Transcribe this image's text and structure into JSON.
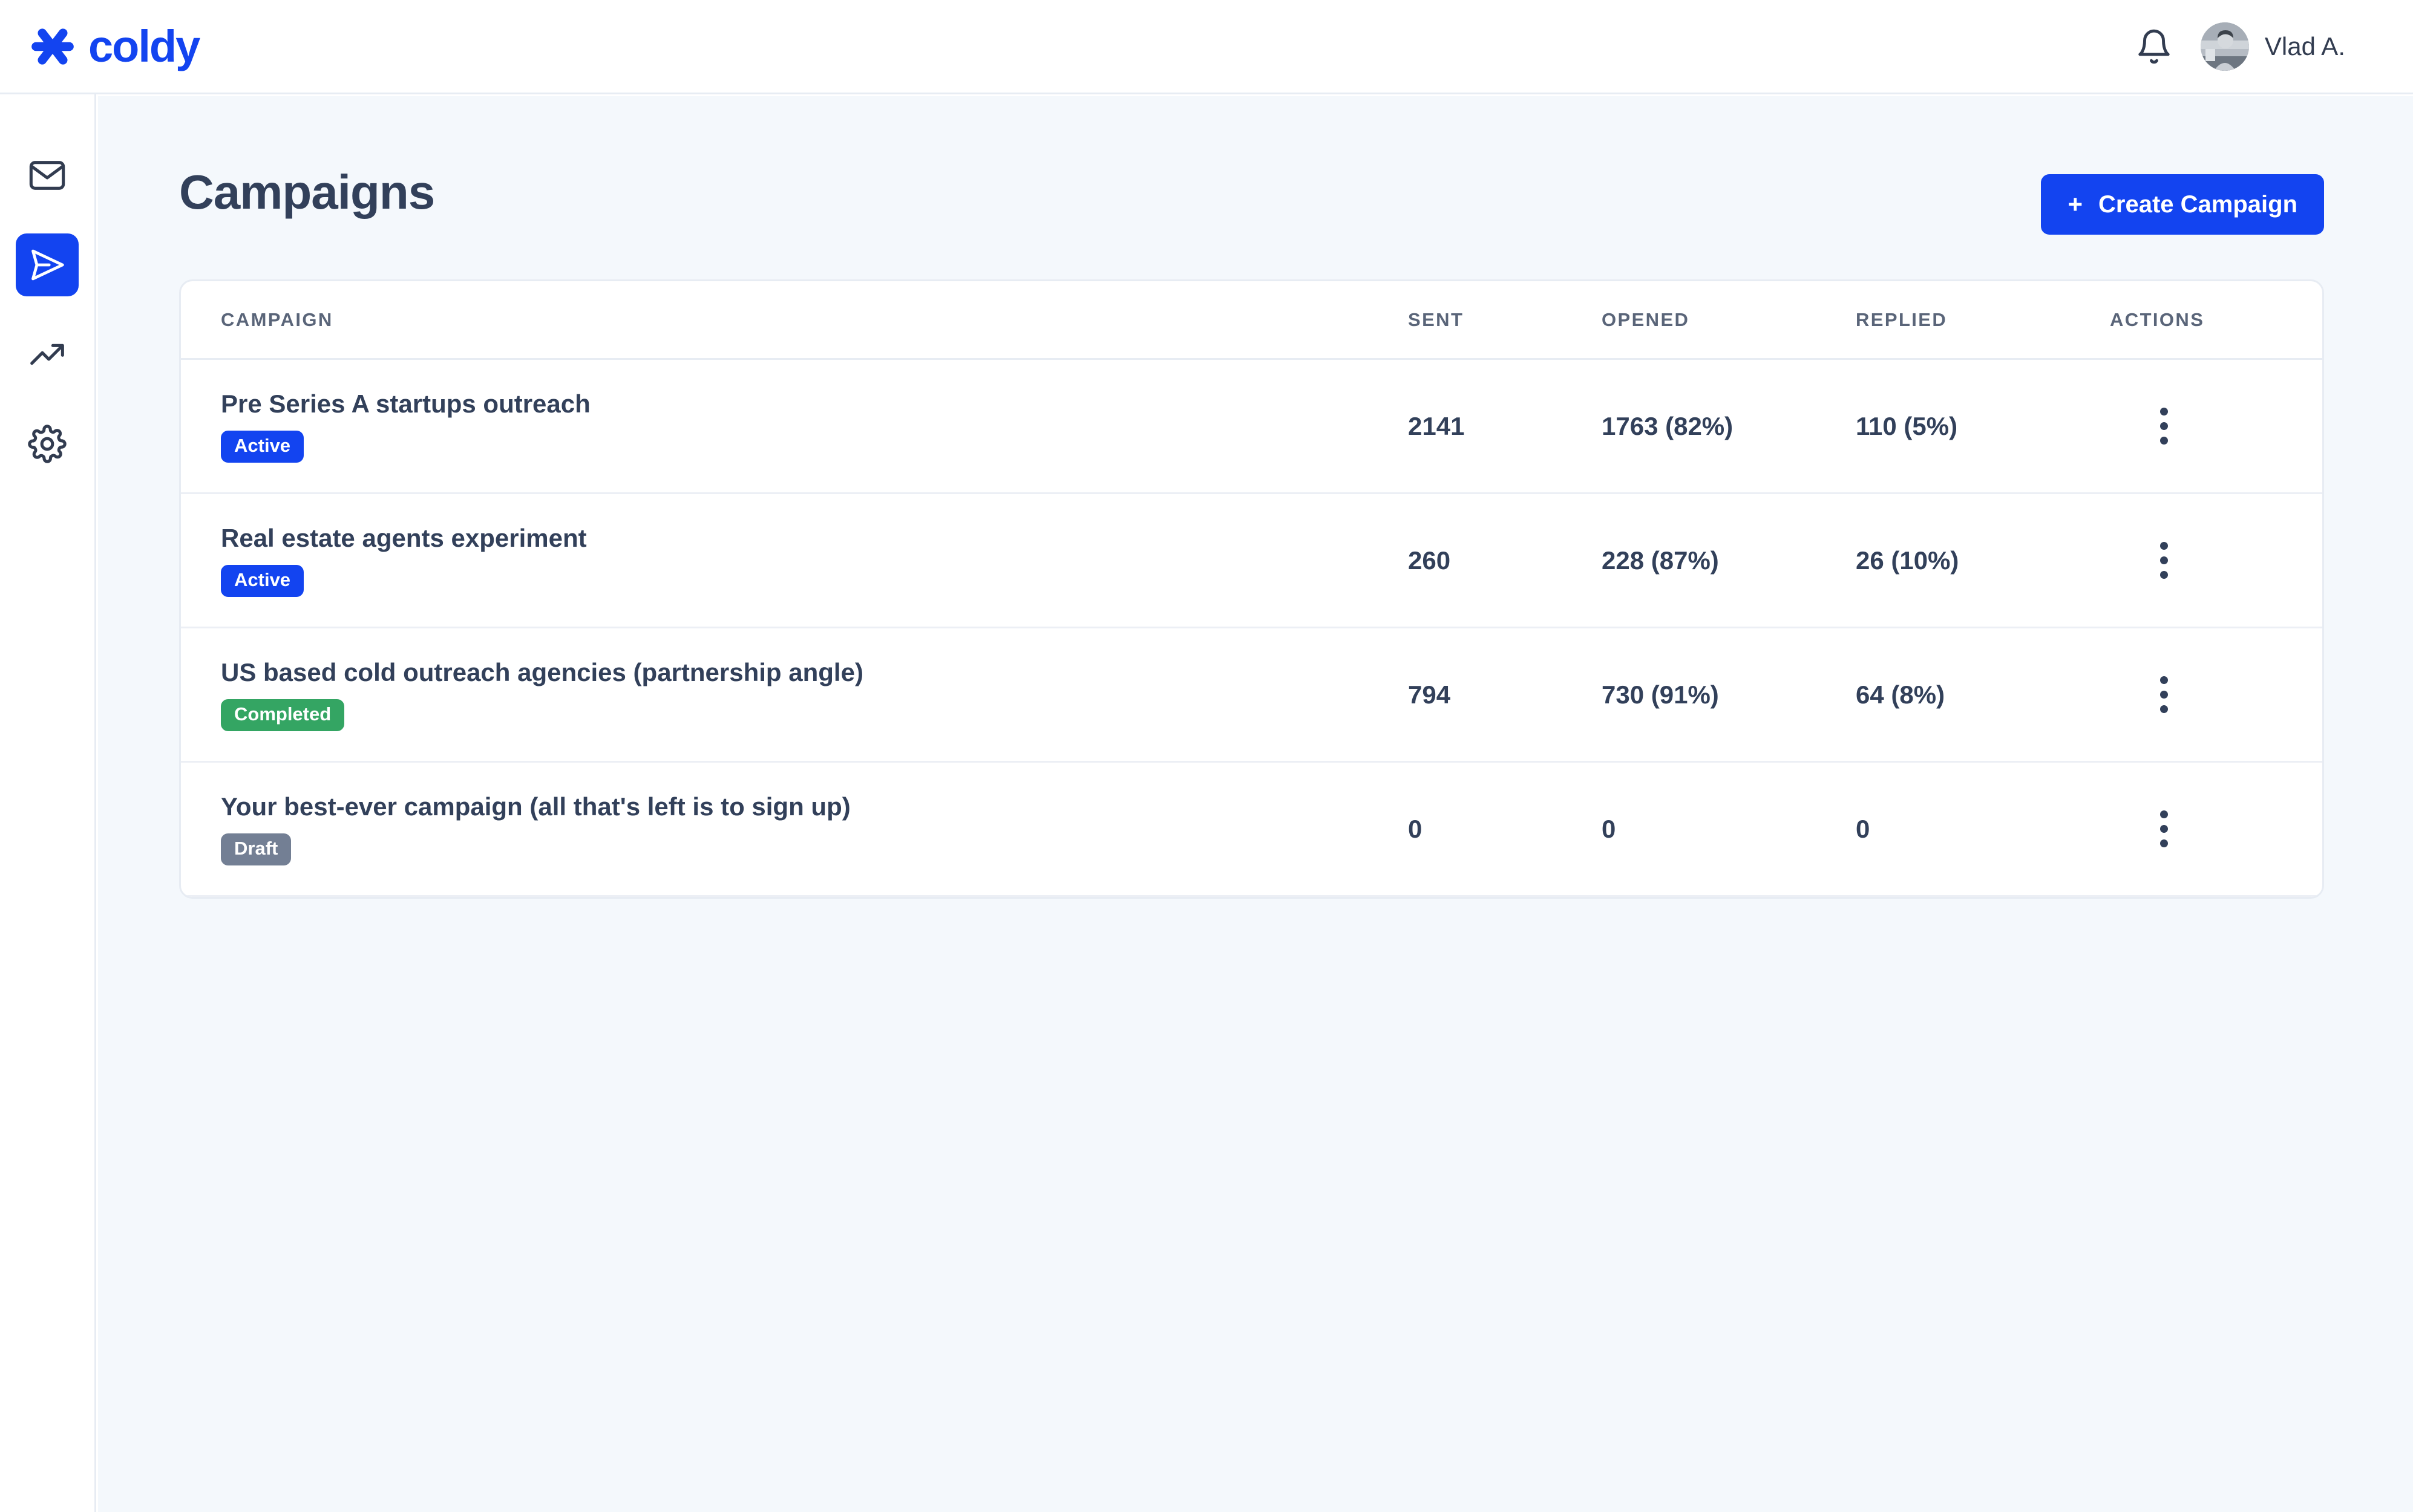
{
  "brand": {
    "name": "coldy",
    "logo_icon": "asterisk-icon",
    "color": "#1344f0"
  },
  "header": {
    "notifications_icon": "bell-icon",
    "avatar_icon": "user-avatar",
    "user_name": "Vlad A."
  },
  "sidebar": {
    "items": [
      {
        "name": "inbox",
        "icon": "envelope-icon",
        "active": false
      },
      {
        "name": "campaigns",
        "icon": "send-icon",
        "active": true
      },
      {
        "name": "analytics",
        "icon": "trending-up-icon",
        "active": false
      },
      {
        "name": "settings",
        "icon": "gear-icon",
        "active": false
      }
    ]
  },
  "page": {
    "title": "Campaigns",
    "create_button": {
      "plus": "+",
      "label": "Create Campaign"
    }
  },
  "table": {
    "columns": [
      "CAMPAIGN",
      "SENT",
      "OPENED",
      "REPLIED",
      "ACTIONS"
    ],
    "rows": [
      {
        "campaign": "Pre Series A startups outreach",
        "status": "Active",
        "status_color": "#1344f0",
        "sent": "2141",
        "opened": "1763 (82%)",
        "replied": "110 (5%)",
        "actions_icon": "kebab-menu-icon"
      },
      {
        "campaign": "Real estate agents experiment",
        "status": "Active",
        "status_color": "#1344f0",
        "sent": "260",
        "opened": "228 (87%)",
        "replied": "26 (10%)",
        "actions_icon": "kebab-menu-icon"
      },
      {
        "campaign": "US based cold outreach agencies (partnership angle)",
        "status": "Completed",
        "status_color": "#34a563",
        "sent": "794",
        "opened": "730 (91%)",
        "replied": "64 (8%)",
        "actions_icon": "kebab-menu-icon"
      },
      {
        "campaign": "Your best-ever campaign (all that's left is to sign up)",
        "status": "Draft",
        "status_color": "#737f94",
        "sent": "0",
        "opened": "0",
        "replied": "0",
        "actions_icon": "kebab-menu-icon"
      }
    ]
  }
}
